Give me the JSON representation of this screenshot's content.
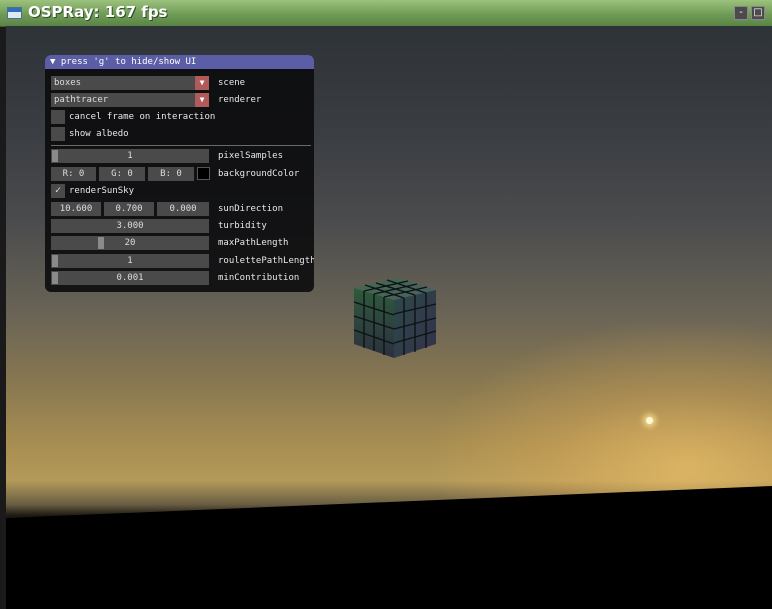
{
  "window": {
    "title": "OSPRay: 167 fps",
    "app_icon": "window-icon",
    "minimize_label": "-",
    "maximize_label": "□"
  },
  "panel": {
    "header": "▼ press 'g' to hide/show UI",
    "scene": {
      "value": "boxes",
      "label": "scene"
    },
    "renderer": {
      "value": "pathtracer",
      "label": "renderer"
    },
    "cancel_frame": {
      "checked": false,
      "label": "cancel frame on interaction"
    },
    "show_albedo": {
      "checked": false,
      "label": "show albedo"
    },
    "pixelSamples": {
      "value": "1",
      "label": "pixelSamples",
      "level": 0.0
    },
    "backgroundColor": {
      "r": "R:  0",
      "g": "G:  0",
      "b": "B:  0",
      "label": "backgroundColor",
      "swatch": "#000000"
    },
    "renderSunSky": {
      "checked": true,
      "check_glyph": "✓",
      "label": "renderSunSky"
    },
    "sunDirection": {
      "x": "10.600",
      "y": "0.700",
      "z": "0.000",
      "label": "sunDirection"
    },
    "turbidity": {
      "value": "3.000",
      "label": "turbidity"
    },
    "maxPathLength": {
      "value": "20",
      "label": "maxPathLength",
      "level": 0.4
    },
    "roulettePathLength": {
      "value": "1",
      "label": "roulettePathLength",
      "level": 0.0
    },
    "minContribution": {
      "value": "0.001",
      "label": "minContribution",
      "level": 0.0
    }
  },
  "colors": {
    "title_bar": "#6f9b56",
    "panel_header": "#5b5ea6",
    "combo_arrow": "#b05a5a"
  }
}
